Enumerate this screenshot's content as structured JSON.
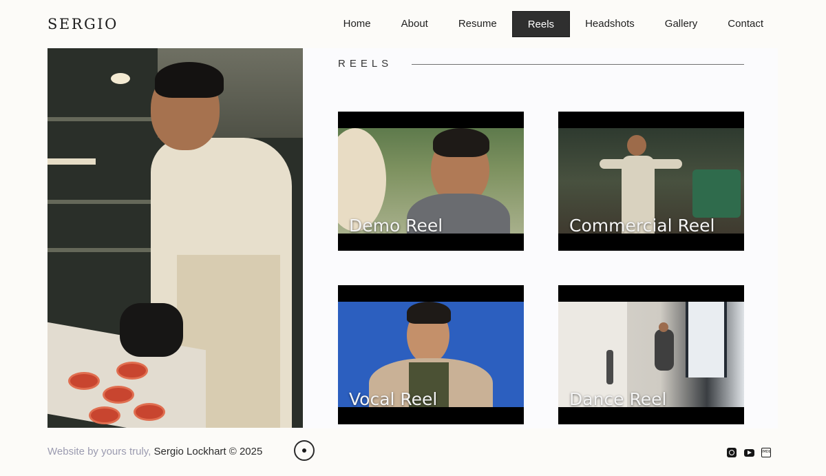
{
  "site": {
    "logo": "SERGIO"
  },
  "nav": {
    "items": [
      {
        "label": "Home",
        "active": false
      },
      {
        "label": "About",
        "active": false
      },
      {
        "label": "Resume",
        "active": false
      },
      {
        "label": "Reels",
        "active": true
      },
      {
        "label": "Headshots",
        "active": false
      },
      {
        "label": "Gallery",
        "active": false
      },
      {
        "label": "Contact",
        "active": false
      }
    ]
  },
  "reels": {
    "title": "REELS",
    "items": [
      {
        "label": "Demo Reel"
      },
      {
        "label": "Commercial Reel"
      },
      {
        "label": "Vocal Reel"
      },
      {
        "label": "Dance Reel"
      }
    ]
  },
  "footer": {
    "credit_prefix": "Website by yours truly,",
    "credit_name": "Sergio Lockhart © 2025",
    "social_icons": [
      "instagram-icon",
      "youtube-icon",
      "imdb-icon"
    ],
    "imdb_text": "IMDb"
  },
  "colors": {
    "background": "#fcfbf8",
    "nav_active_bg": "#2f2f2f",
    "muted_text": "#9b9bb0"
  }
}
